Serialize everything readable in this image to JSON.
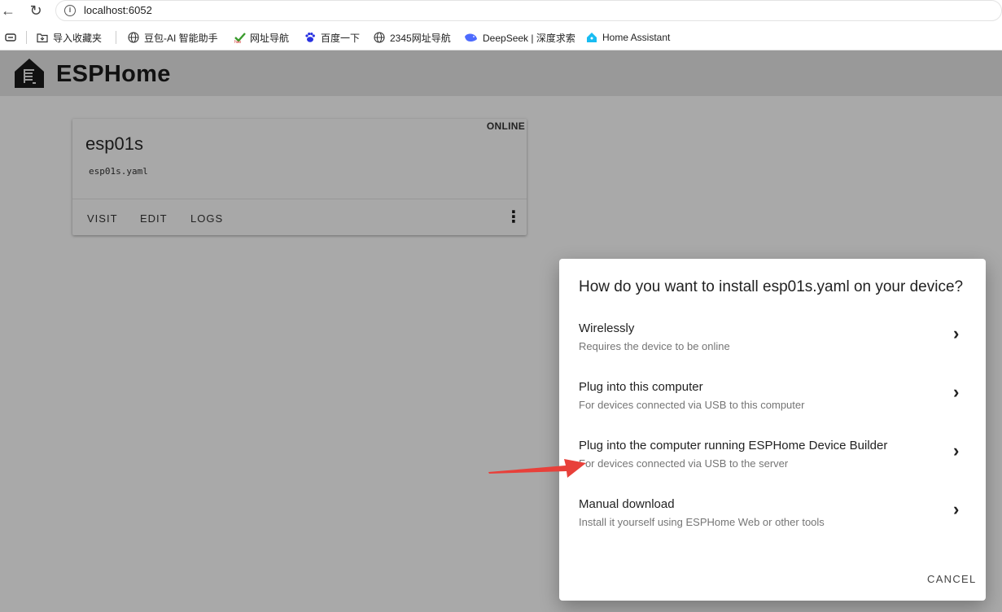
{
  "browser": {
    "url": "localhost:6052",
    "bookmarks": [
      {
        "label": "导入收藏夹",
        "icon": "folder-import-icon"
      },
      {
        "label": "豆包-AI 智能助手",
        "icon": "globe-icon"
      },
      {
        "label": "网址导航",
        "icon": "hao-icon"
      },
      {
        "label": "百度一下",
        "icon": "baidu-paw-icon"
      },
      {
        "label": "2345网址导航",
        "icon": "globe-icon"
      },
      {
        "label": "DeepSeek | 深度求索",
        "icon": "deepseek-whale-icon"
      },
      {
        "label": "Home Assistant",
        "icon": "home-assistant-icon"
      }
    ]
  },
  "app": {
    "title": "ESPHome"
  },
  "device_card": {
    "status": "ONLINE",
    "name": "esp01s",
    "file": "esp01s.yaml",
    "actions": [
      "VISIT",
      "EDIT",
      "LOGS"
    ]
  },
  "dialog": {
    "title": "How do you want to install esp01s.yaml on your device?",
    "options": [
      {
        "title": "Wirelessly",
        "subtitle": "Requires the device to be online"
      },
      {
        "title": "Plug into this computer",
        "subtitle": "For devices connected via USB to this computer"
      },
      {
        "title": "Plug into the computer running ESPHome Device Builder",
        "subtitle": "For devices connected via USB to the server"
      },
      {
        "title": "Manual download",
        "subtitle": "Install it yourself using ESPHome Web or other tools"
      }
    ],
    "cancel_label": "CANCEL"
  },
  "colors": {
    "overlay": "#a9a9a9",
    "appbar": "#999999",
    "annotation_arrow": "#e8403a"
  }
}
